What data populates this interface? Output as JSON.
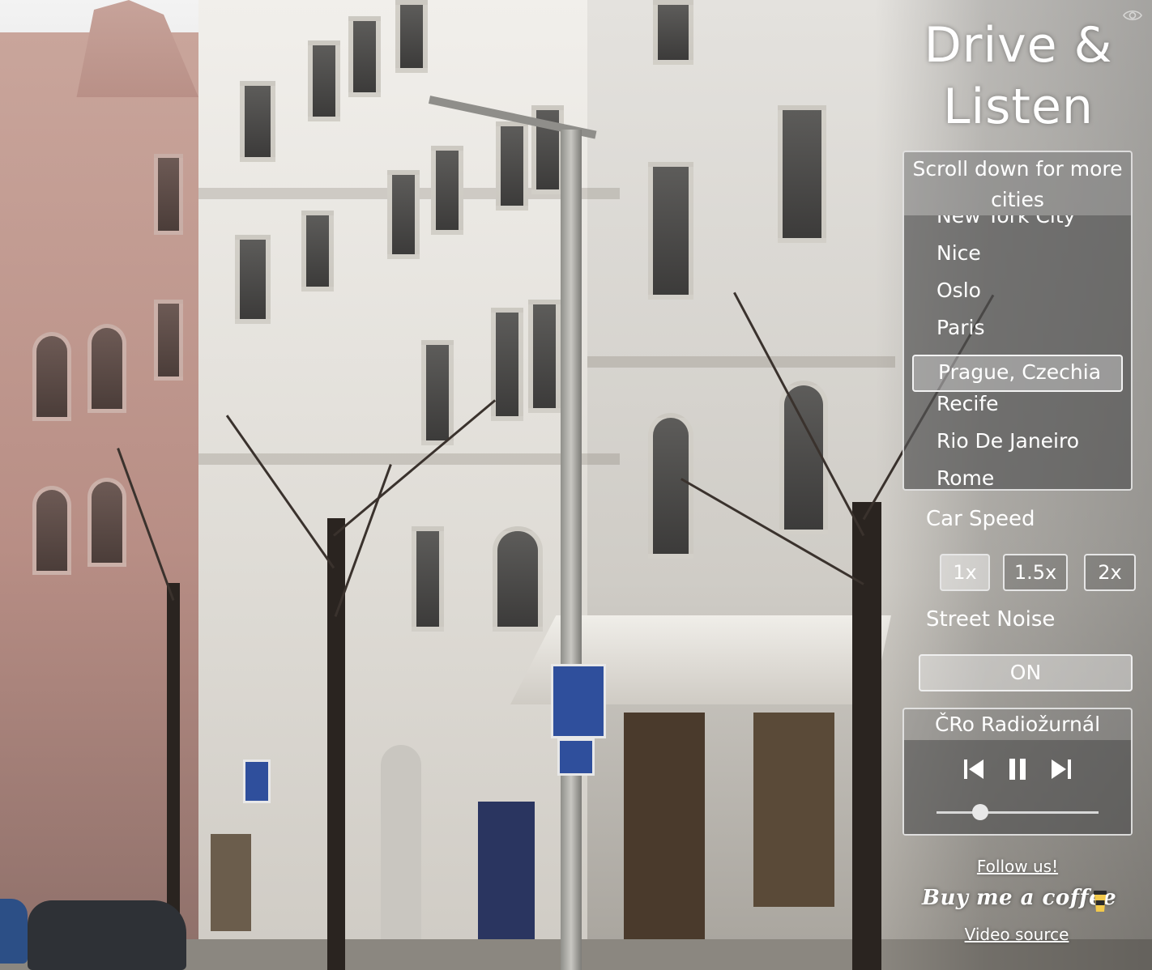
{
  "app": {
    "title_line1": "Drive &",
    "title_line2": "Listen"
  },
  "cities": {
    "hint": "Scroll down for more cities",
    "items": [
      "New York City",
      "Nice",
      "Oslo",
      "Paris",
      "Prague, Czechia",
      "Recife",
      "Rio De Janeiro",
      "Rome"
    ],
    "selected": "Prague, Czechia"
  },
  "speed": {
    "label": "Car Speed",
    "options": [
      "1x",
      "1.5x",
      "2x"
    ],
    "selected": "1x"
  },
  "noise": {
    "label": "Street Noise",
    "state": "ON"
  },
  "player": {
    "station": "ČRo Radiožurnál",
    "volume": 0.27
  },
  "links": {
    "follow": "Follow us!",
    "coffee": "Buy me a coffee",
    "video_source": "Video source"
  },
  "icons": {
    "eye": "eye-icon",
    "prev": "skip-previous-icon",
    "pause": "pause-icon",
    "next": "skip-next-icon",
    "cup": "coffee-cup-icon"
  }
}
